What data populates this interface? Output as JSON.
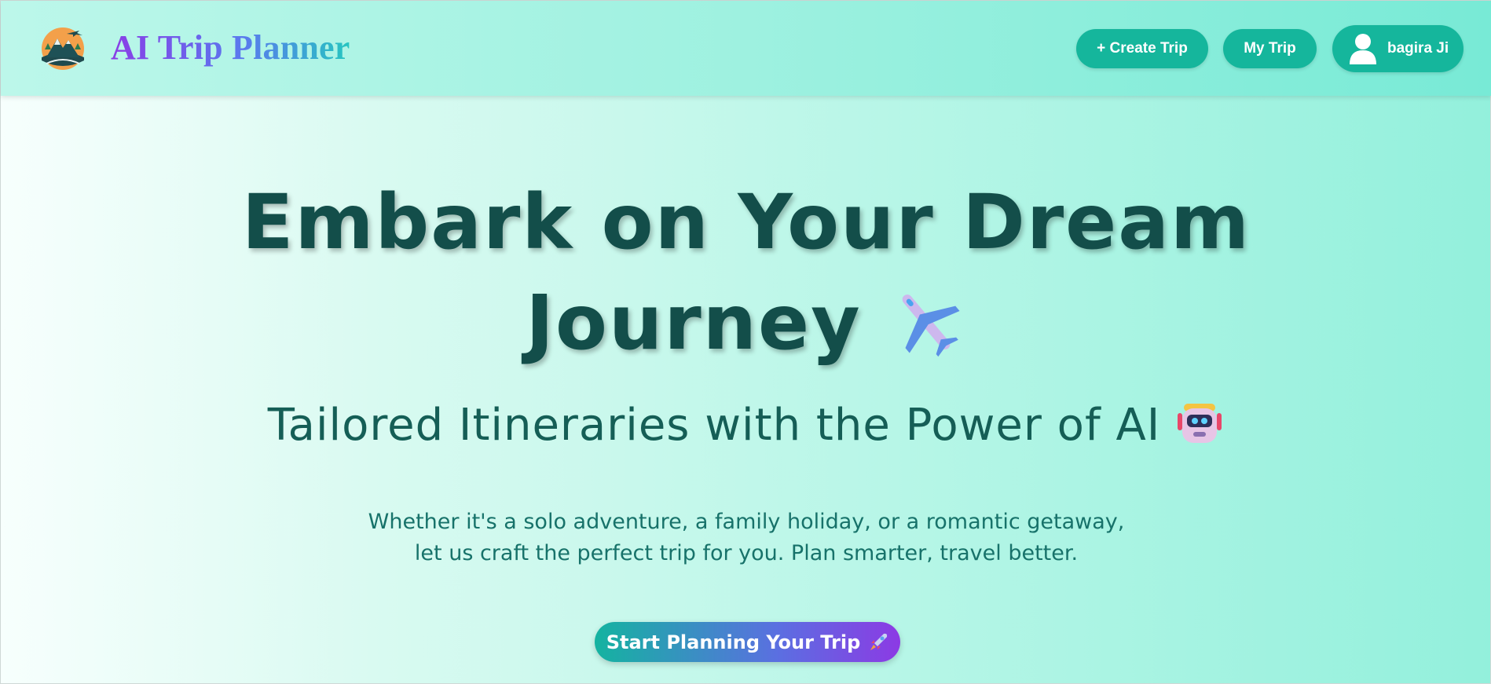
{
  "header": {
    "app_title": "AI Trip Planner",
    "logo_icon": "mountain-airplane-logo",
    "nav": {
      "create_trip_label": "+ Create Trip",
      "my_trip_label": "My Trip",
      "user_name": "bagira Ji",
      "user_icon": "user-avatar-icon"
    }
  },
  "hero": {
    "title_line1": "Embark on Your Dream",
    "title_line2": "Journey",
    "title_emoji": "airplane-emoji",
    "subtitle": "Tailored Itineraries with the Power of AI",
    "subtitle_emoji": "robot-emoji",
    "description_line1": "Whether it's a solo adventure, a family holiday, or a romantic getaway,",
    "description_line2": "let us craft the perfect trip for you. Plan smarter, travel better.",
    "cta_label": "Start Planning Your Trip",
    "cta_icon": "rocket-emoji"
  },
  "colors": {
    "accent": "#15b69c",
    "title_text": "#134e4a",
    "gradient_purple": "#8c3ae4",
    "gradient_teal": "#14b3a0"
  }
}
